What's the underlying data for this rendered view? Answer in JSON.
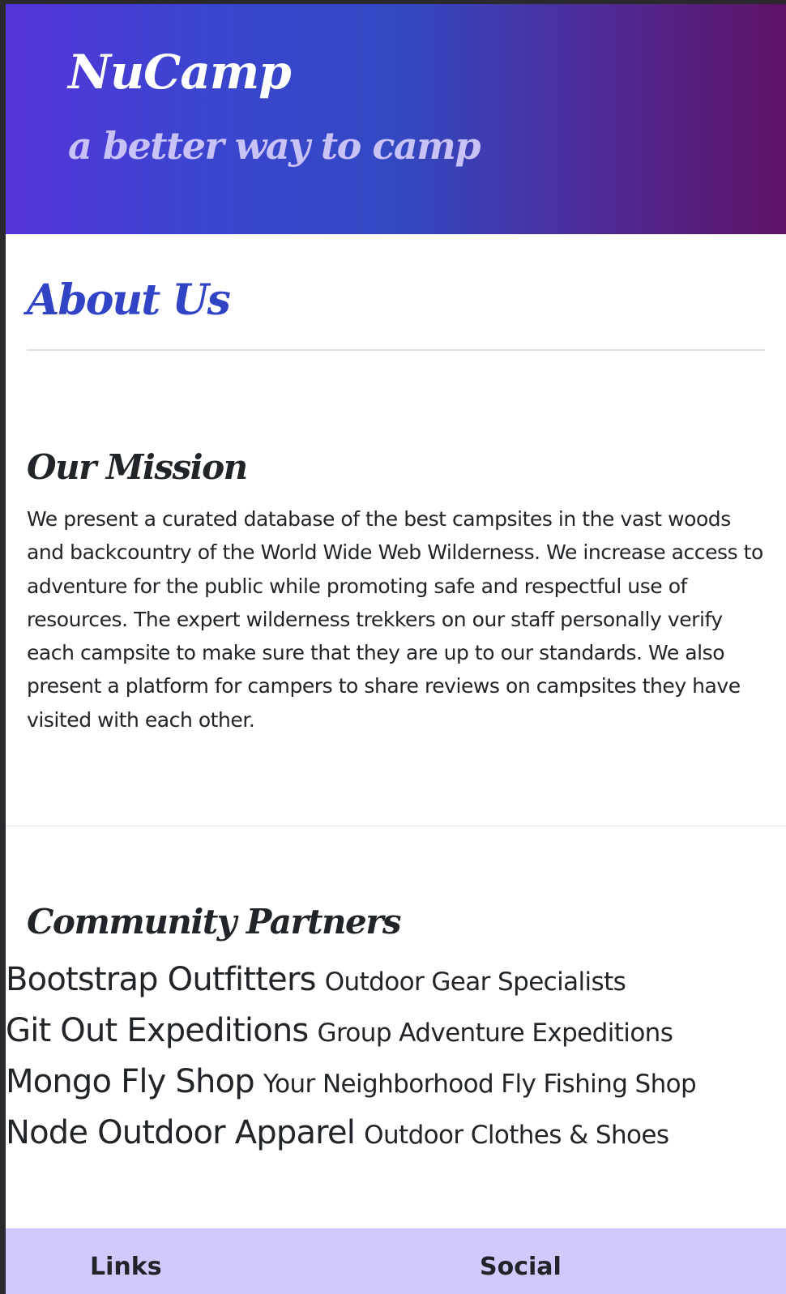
{
  "header": {
    "brand": "NuCamp",
    "tagline": "a better way to camp"
  },
  "about": {
    "title": "About Us"
  },
  "mission": {
    "title": "Our Mission",
    "body": "We present a curated database of the best campsites in the vast woods and backcountry of the World Wide Web Wilderness. We increase access to adventure for the public while promoting safe and respectful use of resources. The expert wilderness trekkers on our staff personally verify each campsite to make sure that they are up to our standards. We also present a platform for campers to share reviews on campsites they have visited with each other."
  },
  "partners": {
    "title": "Community Partners",
    "items": [
      {
        "name": "Bootstrap Outfitters",
        "description": "Outdoor Gear Specialists"
      },
      {
        "name": "Git Out Expeditions",
        "description": "Group Adventure Expeditions"
      },
      {
        "name": "Mongo Fly Shop",
        "description": "Your Neighborhood Fly Fishing Shop"
      },
      {
        "name": "Node Outdoor Apparel",
        "description": "Outdoor Clothes & Shoes"
      }
    ]
  },
  "footer": {
    "links_title": "Links",
    "social_title": "Social"
  },
  "colors": {
    "header_gradient_start": "#5534d9",
    "header_gradient_mid": "#3249c2",
    "header_gradient_end": "#5f1266",
    "tagline": "#c9c2f7",
    "about_title": "#3144c6",
    "footer_background": "#d1c8fb"
  }
}
